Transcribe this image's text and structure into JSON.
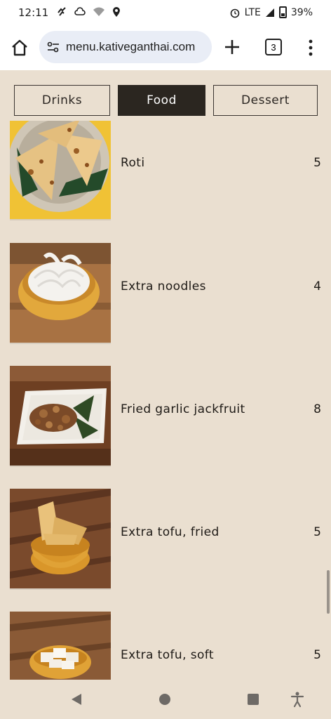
{
  "status_bar": {
    "time": "12:11",
    "network": "LTE",
    "battery": "39%"
  },
  "browser": {
    "url": "menu.kativeganthai.com",
    "tab_count": "3"
  },
  "category_tabs": [
    {
      "label": "Drinks",
      "active": false
    },
    {
      "label": "Food",
      "active": true
    },
    {
      "label": "Dessert",
      "active": false
    }
  ],
  "menu_items": [
    {
      "name": "Roti",
      "price": "5"
    },
    {
      "name": "Extra noodles",
      "price": "4"
    },
    {
      "name": "Fried garlic jackfruit",
      "price": "8"
    },
    {
      "name": "Extra tofu, fried",
      "price": "5"
    },
    {
      "name": "Extra tofu, soft",
      "price": "5"
    }
  ],
  "colors": {
    "page_background": "#eadfd0",
    "active_tab": "#2b2620",
    "url_pill": "#e9edf6"
  }
}
